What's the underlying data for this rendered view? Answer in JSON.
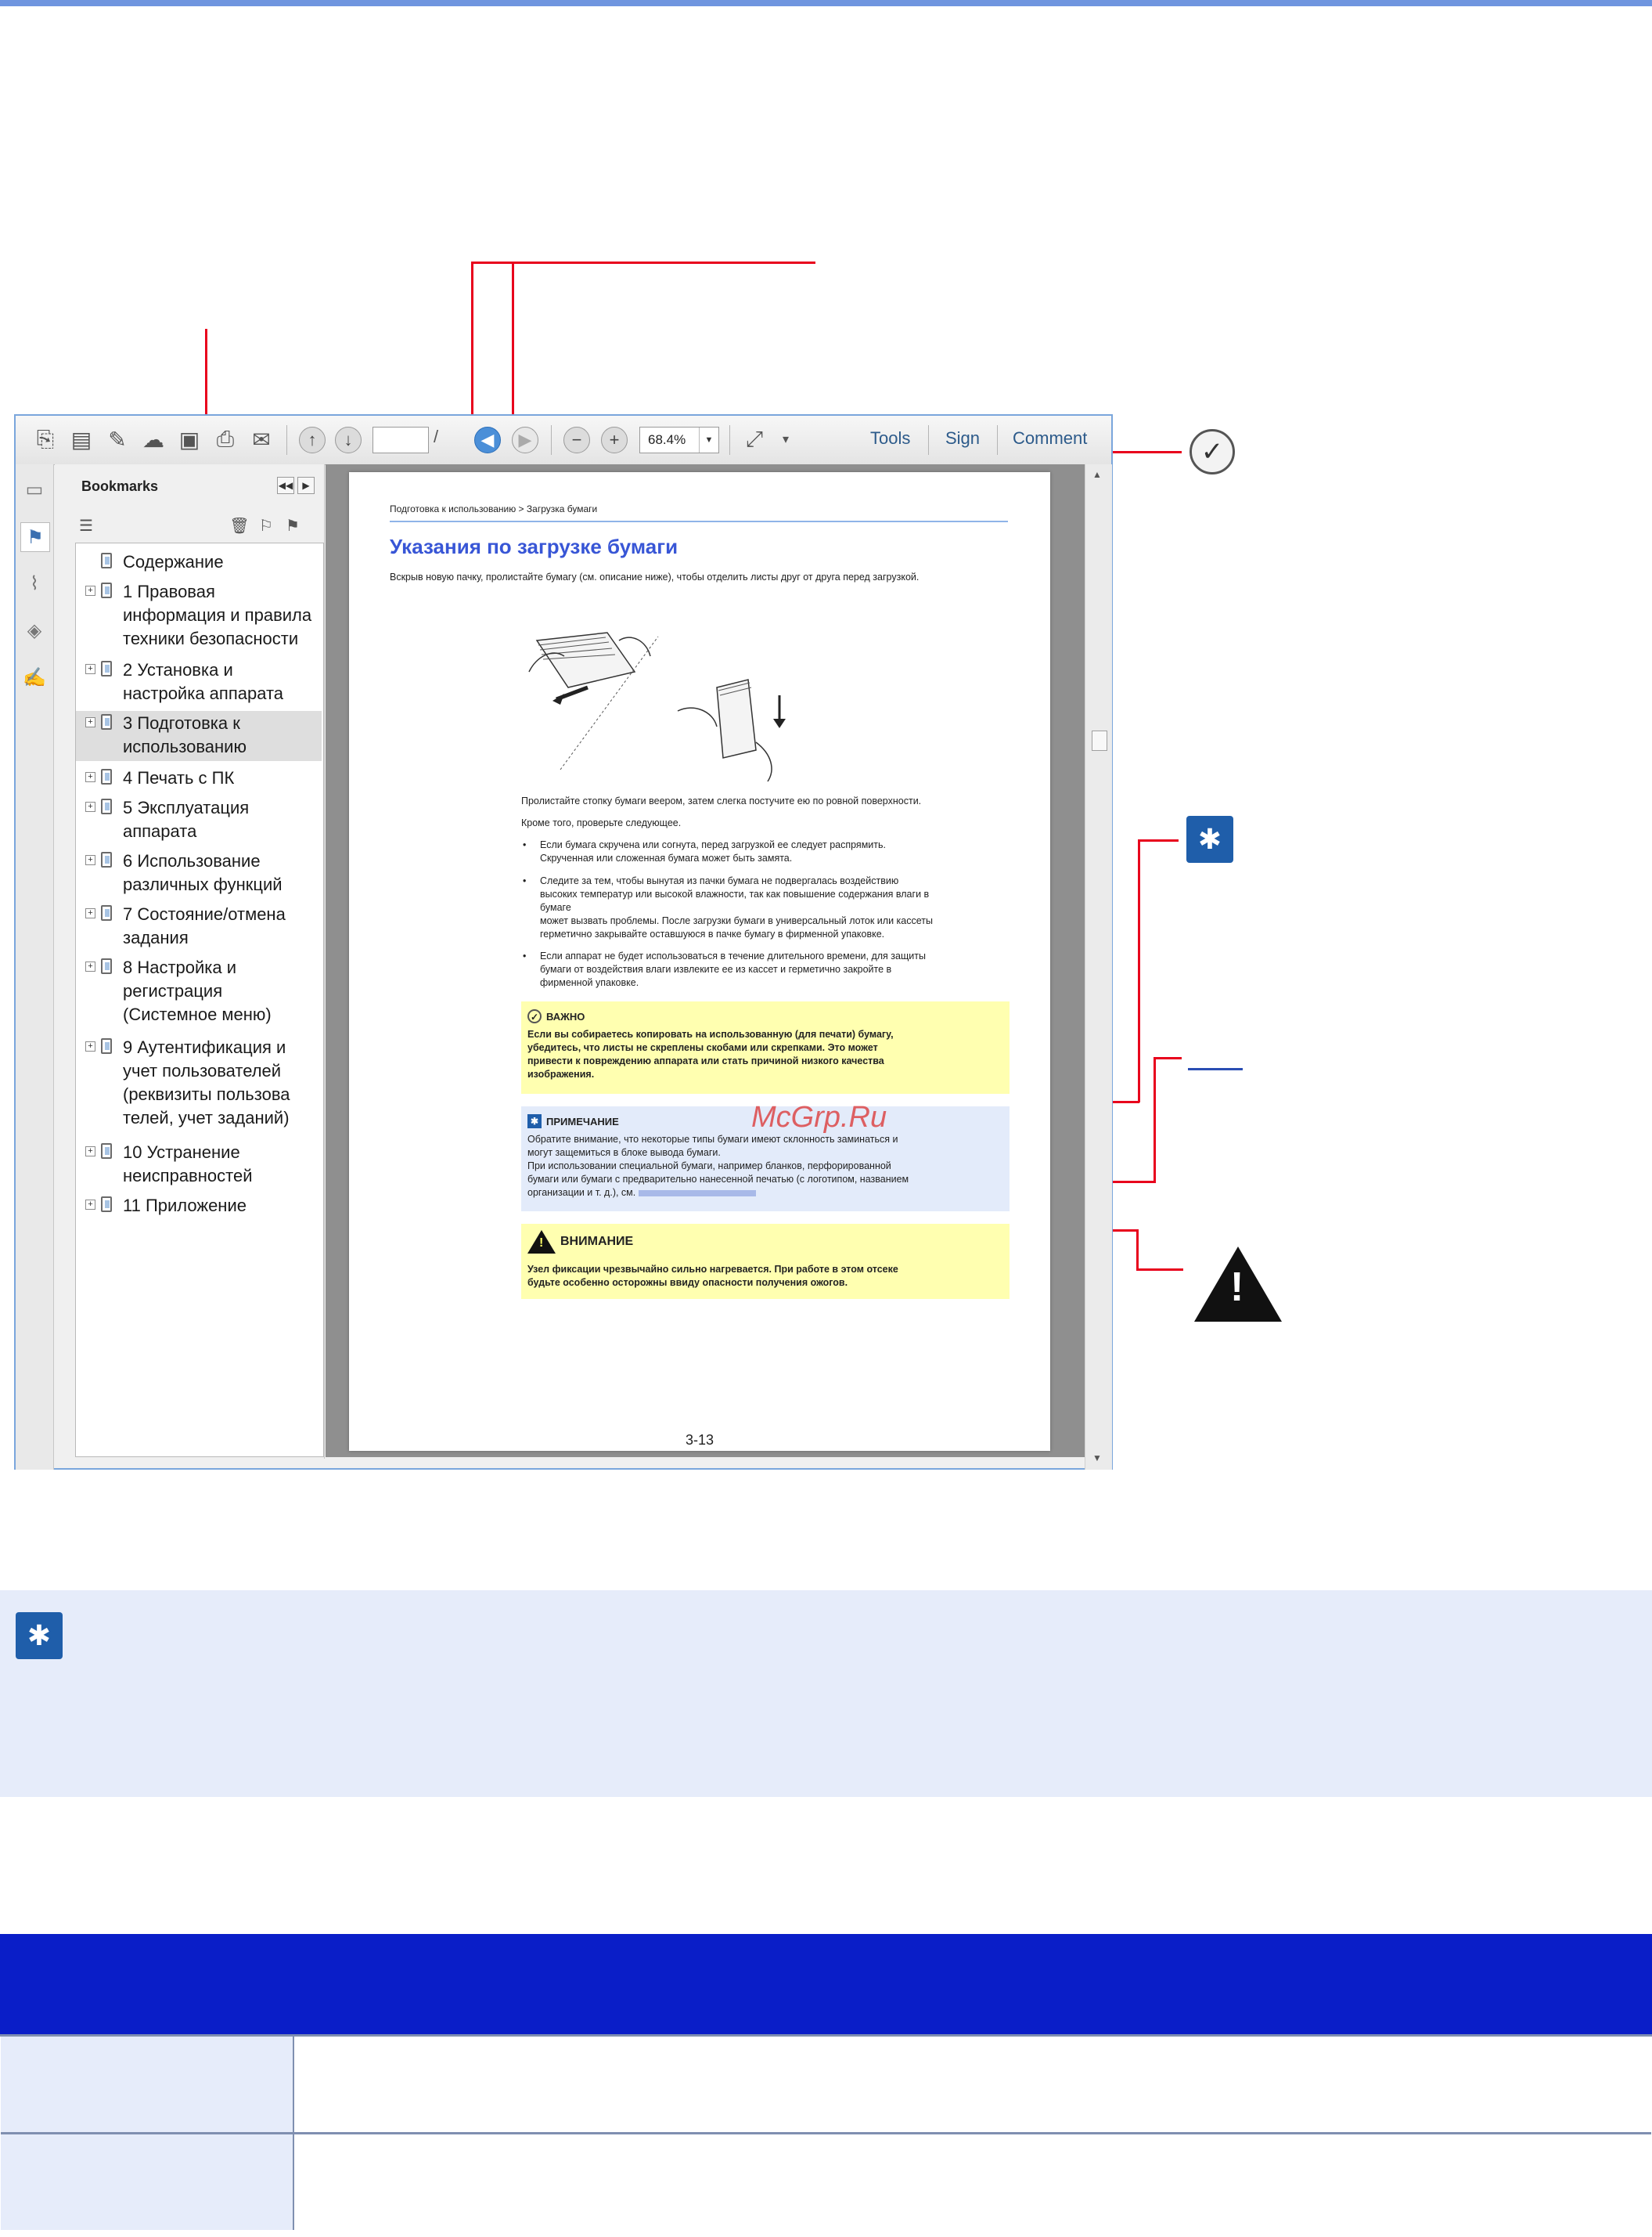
{
  "toolbar": {
    "zoom_value": "68.4%",
    "tools_label": "Tools",
    "sign_label": "Sign",
    "comment_label": "Comment",
    "page_separator": "/"
  },
  "bookmarks": {
    "title": "Bookmarks",
    "items": [
      {
        "label": "Содержание",
        "expandable": false
      },
      {
        "label": "1 Правовая\nинформация и правила\nтехники безопасности",
        "expandable": true
      },
      {
        "label": "2 Установка и\nнастройка аппарата",
        "expandable": true
      },
      {
        "label": "3 Подготовка к\nиспользованию",
        "expandable": true,
        "selected": true
      },
      {
        "label": "4 Печать с ПК",
        "expandable": true
      },
      {
        "label": "5 Эксплуатация\nаппарата",
        "expandable": true
      },
      {
        "label": "6 Использование\nразличных функций",
        "expandable": true
      },
      {
        "label": "7 Состояние/отмена\nзадания",
        "expandable": true
      },
      {
        "label": "8 Настройка и\nрегистрация\n(Системное меню)",
        "expandable": true
      },
      {
        "label": "9 Аутентификация и\nучет пользователей\n(реквизиты пользова\nтелей, учет заданий)",
        "expandable": true
      },
      {
        "label": "10 Устранение\nнеисправностей",
        "expandable": true
      },
      {
        "label": "11 Приложение",
        "expandable": true
      }
    ]
  },
  "document": {
    "breadcrumb": "Подготовка к использованию > Загрузка бумаги",
    "heading": "Указания по загрузке бумаги",
    "intro": "Вскрыв новую пачку, пролистайте бумагу (см. описание ниже), чтобы отделить листы друг от друга перед загрузкой.",
    "para1": "Пролистайте стопку бумаги веером, затем слегка постучите ею по ровной поверхности.",
    "para2": "Кроме того, проверьте следующее.",
    "bullets": [
      "Если бумага скручена или согнута, перед загрузкой ее следует распрямить.\nСкрученная или сложенная бумага может быть замята.",
      "Следите за тем, чтобы вынутая из пачки бумага не подвергалась воздействию\nвысоких температур или высокой влажности, так как повышение содержания влаги в\nбумаге\nможет вызвать проблемы. После загрузки бумаги в универсальный лоток или кассеты\nгерметично закрывайте оставшуюся в пачке бумагу в фирменной упаковке.",
      "Если аппарат не будет использоваться в течение длительного времени, для защиты\nбумаги от воздействия влаги извлеките ее из кассет и герметично закройте в\nфирменной упаковке."
    ],
    "important": {
      "title": "ВАЖНО",
      "body": "Если вы собираетесь копировать на использованную (для печати) бумагу,\nубедитесь, что листы не скреплены скобами или скрепками. Это может\nпривести к повреждению аппарата или стать причиной низкого качества\nизображения."
    },
    "note": {
      "title": "ПРИМЕЧАНИЕ",
      "body": "Обратите внимание, что некоторые типы бумаги имеют склонность заминаться и\nмогут защемиться в блоке вывода бумаги.\nПри использовании специальной бумаги, например бланков, перфорированной\nбумаги или бумаги с предварительно нанесенной печатью (с логотипом, названием",
      "body_last": "организации и т. д.), см."
    },
    "caution": {
      "title": "ВНИМАНИЕ",
      "body": "Узел фиксации чрезвычайно сильно нагревается. При работе в этом отсеке\nбудьте особенно осторожны ввиду опасности получения ожогов."
    },
    "page_number": "3-13"
  },
  "watermark": "McGrp.Ru",
  "colors": {
    "callout": "#e8001c",
    "heading_blue": "#3856d6",
    "table_header": "#0a1ec8",
    "note_band": "#e6ecfa",
    "important_bg": "#ffffb0"
  }
}
